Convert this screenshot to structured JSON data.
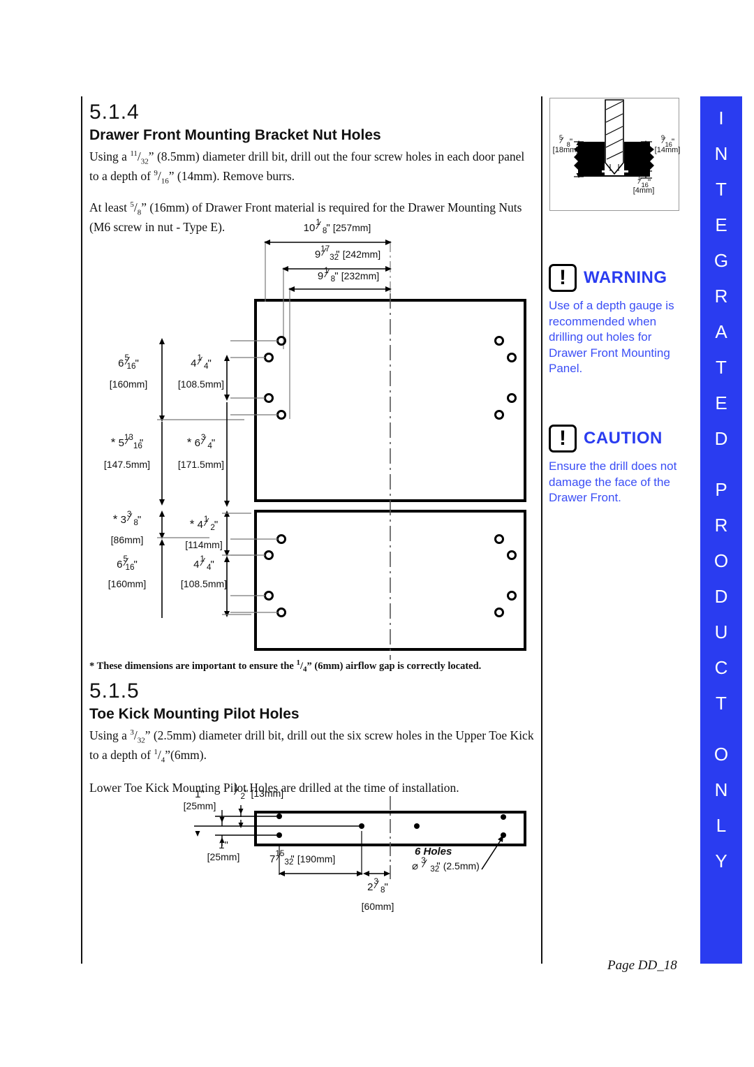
{
  "page": {
    "number_label": "Page DD_18",
    "tab_letters": [
      "I",
      "N",
      "T",
      "E",
      "G",
      "R",
      "A",
      "T",
      "E",
      "D",
      "",
      "P",
      "R",
      "O",
      "D",
      "U",
      "C",
      "T",
      "",
      "O",
      "N",
      "L",
      "Y"
    ],
    "tab_text": "INTEGRATED PRODUCT ONLY",
    "accent_color": "#2a3cf0"
  },
  "section_514": {
    "number": "5.1.4",
    "title": "Drawer Front Mounting Bracket Nut Holes",
    "paragraph1_parts": {
      "a": "Using a ",
      "frac1_num": "11",
      "frac1_den": "32",
      "b": "” (8.5mm) diameter drill bit, drill out the four screw holes in each door panel to a depth of ",
      "frac2_num": "9",
      "frac2_den": "16",
      "c": "” (14mm). Remove burrs."
    },
    "paragraph2_parts": {
      "a": "At least ",
      "frac1_num": "5",
      "frac1_den": "8",
      "b": "” (16mm) of Drawer Front material is required for the Drawer Mounting Nuts (M6 screw in nut - Type E)."
    },
    "footnote_parts": {
      "a": "* These dimensions are important to ensure the ",
      "frac_num": "1",
      "frac_den": "4",
      "b": "” (6mm)  airflow gap is correctly located."
    }
  },
  "section_515": {
    "number": "5.1.5",
    "title": "Toe Kick Mounting Pilot Holes",
    "paragraph1_parts": {
      "a": "Using a ",
      "frac1_num": "3",
      "frac1_den": "32",
      "b": "” (2.5mm) diameter drill bit, drill out the six screw holes in the Upper Toe Kick to a depth of ",
      "frac2_num": "1",
      "frac2_den": "4",
      "c": "”(6mm)."
    },
    "paragraph2": "Lower Toe Kick Mounting Pilot Holes are drilled at the time of installation."
  },
  "warning": {
    "icon": "exclamation-icon",
    "title": "WARNING",
    "body": "Use of a depth gauge is recommended when drilling out holes for Drawer Front Mounting Panel."
  },
  "caution": {
    "icon": "exclamation-icon",
    "title": "CAUTION",
    "body": "Ensure the drill does not damage the face of the Drawer Front."
  },
  "drill_detail": {
    "left_dim": {
      "whole": "",
      "num": "5",
      "den": "8",
      "unit": "\"",
      "mm": "[18mm]"
    },
    "right_dim": {
      "whole": "",
      "num": "9",
      "den": "16",
      "unit": "\"",
      "mm": "[14mm]"
    },
    "bottom_dim": {
      "whole": "",
      "num": "1",
      "den": "16",
      "unit": "\"",
      "mm": "[4mm]"
    }
  },
  "drawing_front": {
    "horizontal_dims": [
      {
        "whole": "10",
        "num": "1",
        "den": "8",
        "unit": "\"",
        "mm": "[257mm]"
      },
      {
        "whole": "9",
        "num": "17",
        "den": "32",
        "unit": "\"",
        "mm": "[242mm]"
      },
      {
        "whole": "9",
        "num": "1",
        "den": "8",
        "unit": "\"",
        "mm": "[232mm]"
      }
    ],
    "vertical_dims_upper": [
      {
        "star": false,
        "whole": "6",
        "num": "5",
        "den": "16",
        "unit": "\"",
        "mm": "[160mm]"
      },
      {
        "star": false,
        "whole": "4",
        "num": "1",
        "den": "4",
        "unit": "\"",
        "mm": "[108.5mm]"
      },
      {
        "star": true,
        "whole": "5",
        "num": "13",
        "den": "16",
        "unit": "\"",
        "mm": "[147.5mm]"
      },
      {
        "star": true,
        "whole": "6",
        "num": "3",
        "den": "4",
        "unit": "\"",
        "mm": "[171.5mm]"
      }
    ],
    "vertical_dims_lower": [
      {
        "star": true,
        "whole": "3",
        "num": "3",
        "den": "8",
        "unit": "\"",
        "mm": "[86mm]"
      },
      {
        "star": true,
        "whole": "4",
        "num": "1",
        "den": "2",
        "unit": "\"",
        "mm": "[114mm]"
      },
      {
        "star": false,
        "whole": "6",
        "num": "5",
        "den": "16",
        "unit": "\"",
        "mm": "[160mm]"
      },
      {
        "star": false,
        "whole": "4",
        "num": "1",
        "den": "4",
        "unit": "\"",
        "mm": "[108.5mm]"
      }
    ]
  },
  "drawing_toekick": {
    "dims": [
      {
        "whole": "1",
        "num": "",
        "den": "",
        "unit": "\"",
        "mm": "[25mm]"
      },
      {
        "whole": "",
        "num": "1",
        "den": "2",
        "unit": "\"",
        "mm": "[13mm]"
      },
      {
        "whole": "1",
        "num": "",
        "den": "",
        "unit": "\"",
        "mm": "[25mm]"
      },
      {
        "whole": "7",
        "num": "15",
        "den": "32",
        "unit": "\"",
        "mm": "[190mm]"
      },
      {
        "whole": "2",
        "num": "3",
        "den": "8",
        "unit": "\"",
        "mm": "[60mm]"
      }
    ],
    "hole_note_title": "6 Holes",
    "hole_note_dia": {
      "symbol": "⌀",
      "num": "3",
      "den": "32",
      "unit": "\"",
      "mm": "(2.5mm)"
    }
  }
}
